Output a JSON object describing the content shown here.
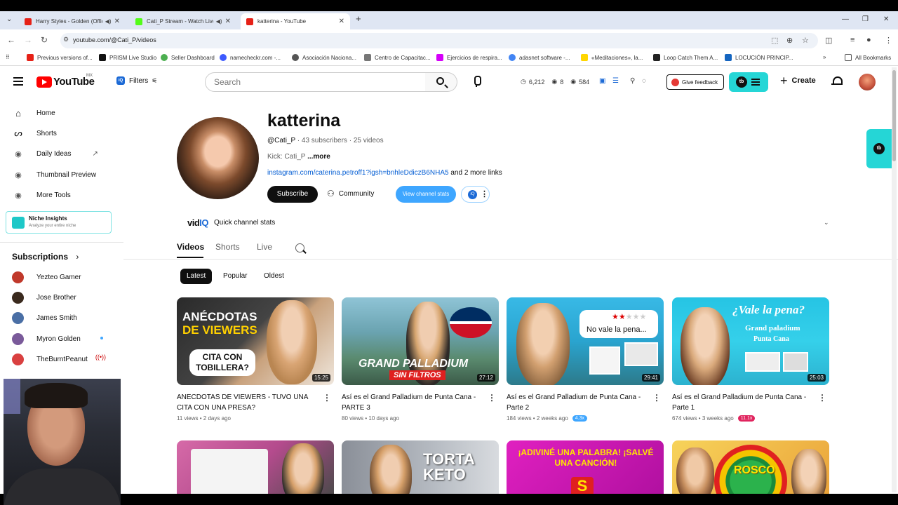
{
  "browser": {
    "tabs": [
      {
        "title": "Harry Styles - Golden (Offic",
        "favicon_color": "#e62117",
        "audio": true
      },
      {
        "title": "Cati_P Stream - Watch Live",
        "favicon_color": "#53fc18",
        "audio": true
      },
      {
        "title": "katterina - YouTube",
        "favicon_color": "#e62117",
        "audio": false
      }
    ],
    "url": "youtube.com/@Cati_P/videos",
    "bookmarks": [
      "Previous versions of...",
      "PRISM Live Studio",
      "Seller Dashboard",
      "namecheckr.com -...",
      "Asociación Naciona...",
      "Centro de Capacitac...",
      "Ejercicios de respira...",
      "adasnet software -...",
      "«Meditaciones», la...",
      "Loop Catch Them A...",
      "LOCUCIÓN PRINCIP...",
      "All Bookmarks"
    ]
  },
  "header": {
    "logo": "YouTube",
    "country": "MX",
    "filters_label": "Filters",
    "search_placeholder": "Search",
    "stats": [
      "6,212",
      "8",
      "584"
    ],
    "feedback_label": "Give feedback",
    "create_label": "Create"
  },
  "sidebar": {
    "items": [
      {
        "label": "Home",
        "icon": "home-icon"
      },
      {
        "label": "Shorts",
        "icon": "shorts-icon"
      },
      {
        "label": "Daily Ideas",
        "icon": "vidiq-icon"
      },
      {
        "label": "Thumbnail Preview",
        "icon": "vidiq-icon"
      },
      {
        "label": "More Tools",
        "icon": "vidiq-icon"
      }
    ],
    "niche": {
      "title": "Niche Insights",
      "subtitle": "Analyze your entire niche"
    },
    "subscriptions_title": "Subscriptions",
    "subscriptions": [
      {
        "name": "Yezteo Gamer",
        "color": "#c0392b",
        "status": ""
      },
      {
        "name": "Jose Brother",
        "color": "#3a2a1e",
        "status": ""
      },
      {
        "name": "James Smith",
        "color": "#4a6fa5",
        "status": ""
      },
      {
        "name": "Myron Golden",
        "color": "#7a5a9a",
        "status": "new"
      },
      {
        "name": "TheBurntPeanut",
        "color": "#d94040",
        "status": "live"
      }
    ]
  },
  "channel": {
    "name": "katterina",
    "handle": "@Cati_P",
    "subscribers": "43 subscribers",
    "videos_count": "25 videos",
    "description": "Kick: Cati_P",
    "more": "...more",
    "link": "instagram.com/caterina.petroff1?igsh=bnhleDdiczB6NHA5",
    "more_links": "and 2 more links",
    "subscribe_label": "Subscribe",
    "community_label": "Community",
    "view_stats_label": "View channel stats",
    "quick_stats_label": "Quick channel stats",
    "tabs": [
      "Videos",
      "Shorts",
      "Live"
    ],
    "chips": [
      "Latest",
      "Popular",
      "Oldest"
    ]
  },
  "videos": [
    {
      "title": "ANECDOTAS DE VIEWERS - TUVO UNA CITA CON UNA PRESA?",
      "duration": "15:25",
      "views": "11 views",
      "age": "2 days ago",
      "badge": "",
      "badge_color": "",
      "thumb_text": [
        "ANÉCDOTAS",
        "DE VIEWERS",
        "CITA CON",
        "TOBILLERA?"
      ]
    },
    {
      "title": "Así es el Grand Palladium de Punta Cana - PARTE 3",
      "duration": "27:12",
      "views": "80 views",
      "age": "10 days ago",
      "badge": "",
      "badge_color": "",
      "thumb_text": [
        "GRAND PALLADIUM",
        "SIN FILTROS"
      ]
    },
    {
      "title": "Así es el Grand Palladium de Punta Cana - Parte 2",
      "duration": "29:41",
      "views": "184 views",
      "age": "2 weeks ago",
      "badge": "4.3x",
      "badge_color": "#3ea6ff",
      "thumb_text": [
        "No vale la pena..."
      ]
    },
    {
      "title": "Así es el Grand Palladium de Punta Cana - Parte 1",
      "duration": "25:03",
      "views": "674 views",
      "age": "3 weeks ago",
      "badge": "11.1x",
      "badge_color": "#e0245e",
      "thumb_text": [
        "¿Vale la pena?",
        "Grand paladium",
        "Punta Cana"
      ]
    }
  ],
  "row2_thumb_text": [
    "",
    "TORTA KETO",
    "¡ADIVINÉ UNA PALABRA! ¡SALVÉ UNA CANCIÓN!",
    "ROSCO"
  ]
}
